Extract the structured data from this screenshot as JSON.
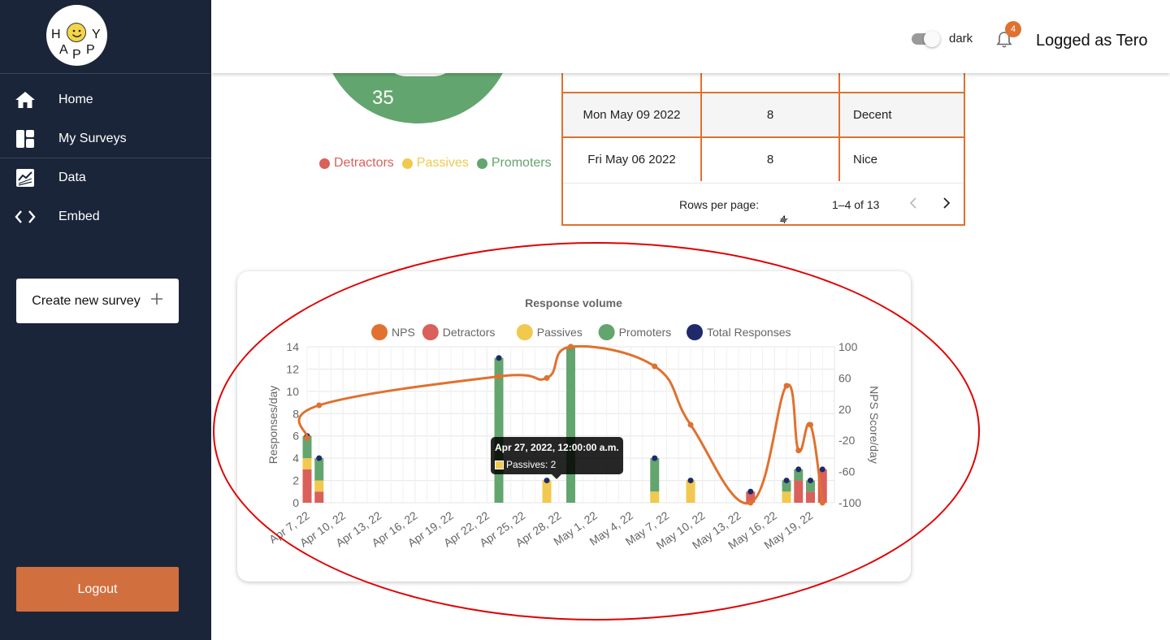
{
  "sidebar": {
    "logo_letters": [
      "H",
      "Y",
      "A",
      "P",
      "P"
    ],
    "nav": [
      {
        "label": "Home",
        "icon": "home-icon"
      },
      {
        "label": "My Surveys",
        "icon": "dashboard-icon"
      },
      {
        "label": "Data",
        "icon": "chart-icon"
      },
      {
        "label": "Embed",
        "icon": "code-icon"
      }
    ],
    "create_label": "Create new survey",
    "logout_label": "Logout"
  },
  "header": {
    "theme_label": "dark",
    "notification_count": "4",
    "user_label": "Logged as Tero"
  },
  "pie": {
    "visible_value": "35",
    "legend": [
      {
        "label": "Detractors",
        "color": "#d9605b"
      },
      {
        "label": "Passives",
        "color": "#f0c94e"
      },
      {
        "label": "Promoters",
        "color": "#63a56e"
      }
    ]
  },
  "table": {
    "rows": [
      {
        "date": "Mon May 09 2022",
        "value": "8",
        "comment": "Decent"
      },
      {
        "date": "Fri May 06 2022",
        "value": "8",
        "comment": "Nice"
      }
    ],
    "rows_per_page_label": "Rows per page:",
    "rows_per_page": "4",
    "range": "1–4 of 13"
  },
  "tooltip": {
    "title": "Apr 27, 2022, 12:00:00 a.m.",
    "body": "Passives: 2"
  },
  "chart_data": {
    "type": "bar",
    "title": "Response volume",
    "ylabel": "Responses/day",
    "y2label": "NPS Score/day",
    "ylim": [
      0,
      14
    ],
    "y2lim": [
      -100,
      100
    ],
    "xlim": [
      "2022-04-07",
      "2022-05-21"
    ],
    "yticks": [
      "0",
      "2",
      "4",
      "6",
      "8",
      "10",
      "12",
      "14"
    ],
    "y2ticks": [
      "-100",
      "-60",
      "-20",
      "20",
      "60",
      "100"
    ],
    "xticks": [
      "Apr 7, 22",
      "Apr 10, 22",
      "Apr 13, 22",
      "Apr 16, 22",
      "Apr 19, 22",
      "Apr 22, 22",
      "Apr 25, 22",
      "Apr 28, 22",
      "May 1, 22",
      "May 4, 22",
      "May 7, 22",
      "May 10, 22",
      "May 13, 22",
      "May 16, 22",
      "May 19, 22"
    ],
    "legend": [
      {
        "label": "NPS",
        "color": "#e0712f"
      },
      {
        "label": "Detractors",
        "color": "#d9605b"
      },
      {
        "label": "Passives",
        "color": "#f0c94e"
      },
      {
        "label": "Promoters",
        "color": "#63a56e"
      },
      {
        "label": "Total Responses",
        "color": "#1f2a6b"
      }
    ],
    "dates": [
      "2022-04-07",
      "2022-04-08",
      "2022-04-23",
      "2022-04-27",
      "2022-04-29",
      "2022-05-06",
      "2022-05-09",
      "2022-05-14",
      "2022-05-17",
      "2022-05-18",
      "2022-05-19",
      "2022-05-20"
    ],
    "series": [
      {
        "name": "Detractors",
        "values": [
          3,
          1,
          0,
          0,
          0,
          0,
          0,
          1,
          0,
          2,
          1,
          3
        ]
      },
      {
        "name": "Passives",
        "values": [
          1,
          1,
          0,
          2,
          0,
          1,
          2,
          0,
          1,
          0,
          0,
          0
        ]
      },
      {
        "name": "Promoters",
        "values": [
          2,
          2,
          13,
          0,
          14,
          3,
          0,
          0,
          1,
          1,
          1,
          0
        ]
      },
      {
        "name": "Total Responses",
        "values": [
          6,
          4,
          13,
          2,
          14,
          4,
          2,
          1,
          2,
          3,
          2,
          3
        ]
      },
      {
        "name": "NPS",
        "values": [
          -17,
          25,
          62,
          60,
          100,
          75,
          0,
          -100,
          50,
          -33,
          0,
          -100
        ]
      }
    ]
  }
}
